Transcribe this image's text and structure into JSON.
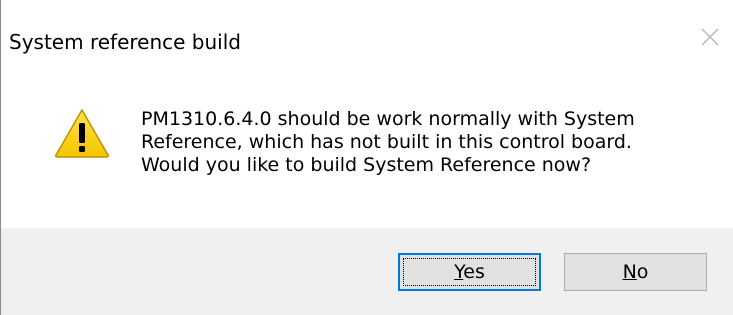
{
  "dialog": {
    "title": "System reference build",
    "message_lines": [
      "PM1310.6.4.0   should be work normally with System",
      "Reference, which has not built in this control board.",
      "Would you like to build System Reference now?"
    ],
    "icon": "warning-icon",
    "buttons": {
      "yes_mnemonic": "Y",
      "yes_rest": "es",
      "no_mnemonic": "N",
      "no_rest": "o"
    },
    "colors": {
      "accent": "#0078d7",
      "footer_bg": "#f0f0f0",
      "button_bg": "#e1e1e1",
      "warning_yellow": "#ffd500"
    }
  }
}
